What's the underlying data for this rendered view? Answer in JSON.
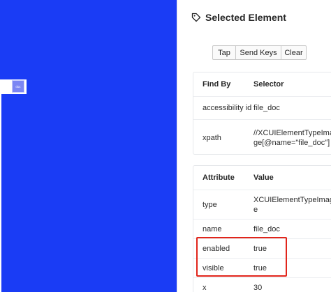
{
  "screen": {
    "thumb_label": "doc"
  },
  "inspector": {
    "title": "Selected Element",
    "actions": {
      "tap": "Tap",
      "send_keys": "Send Keys",
      "clear": "Clear"
    },
    "find_by_table": {
      "headers": [
        "Find By",
        "Selector"
      ],
      "rows": [
        [
          "accessibility id",
          "file_doc"
        ],
        [
          "xpath",
          "//XCUIElementTypeImage[@name=\"file_doc\"]"
        ]
      ]
    },
    "attribute_table": {
      "headers": [
        "Attribute",
        "Value"
      ],
      "rows": [
        [
          "type",
          "XCUIElementTypeImage"
        ],
        [
          "name",
          "file_doc"
        ],
        [
          "enabled",
          "true"
        ],
        [
          "visible",
          "true"
        ],
        [
          "x",
          "30"
        ]
      ]
    }
  },
  "colors": {
    "screen_background": "#1a3cf5",
    "highlight_border": "#e1251b"
  }
}
